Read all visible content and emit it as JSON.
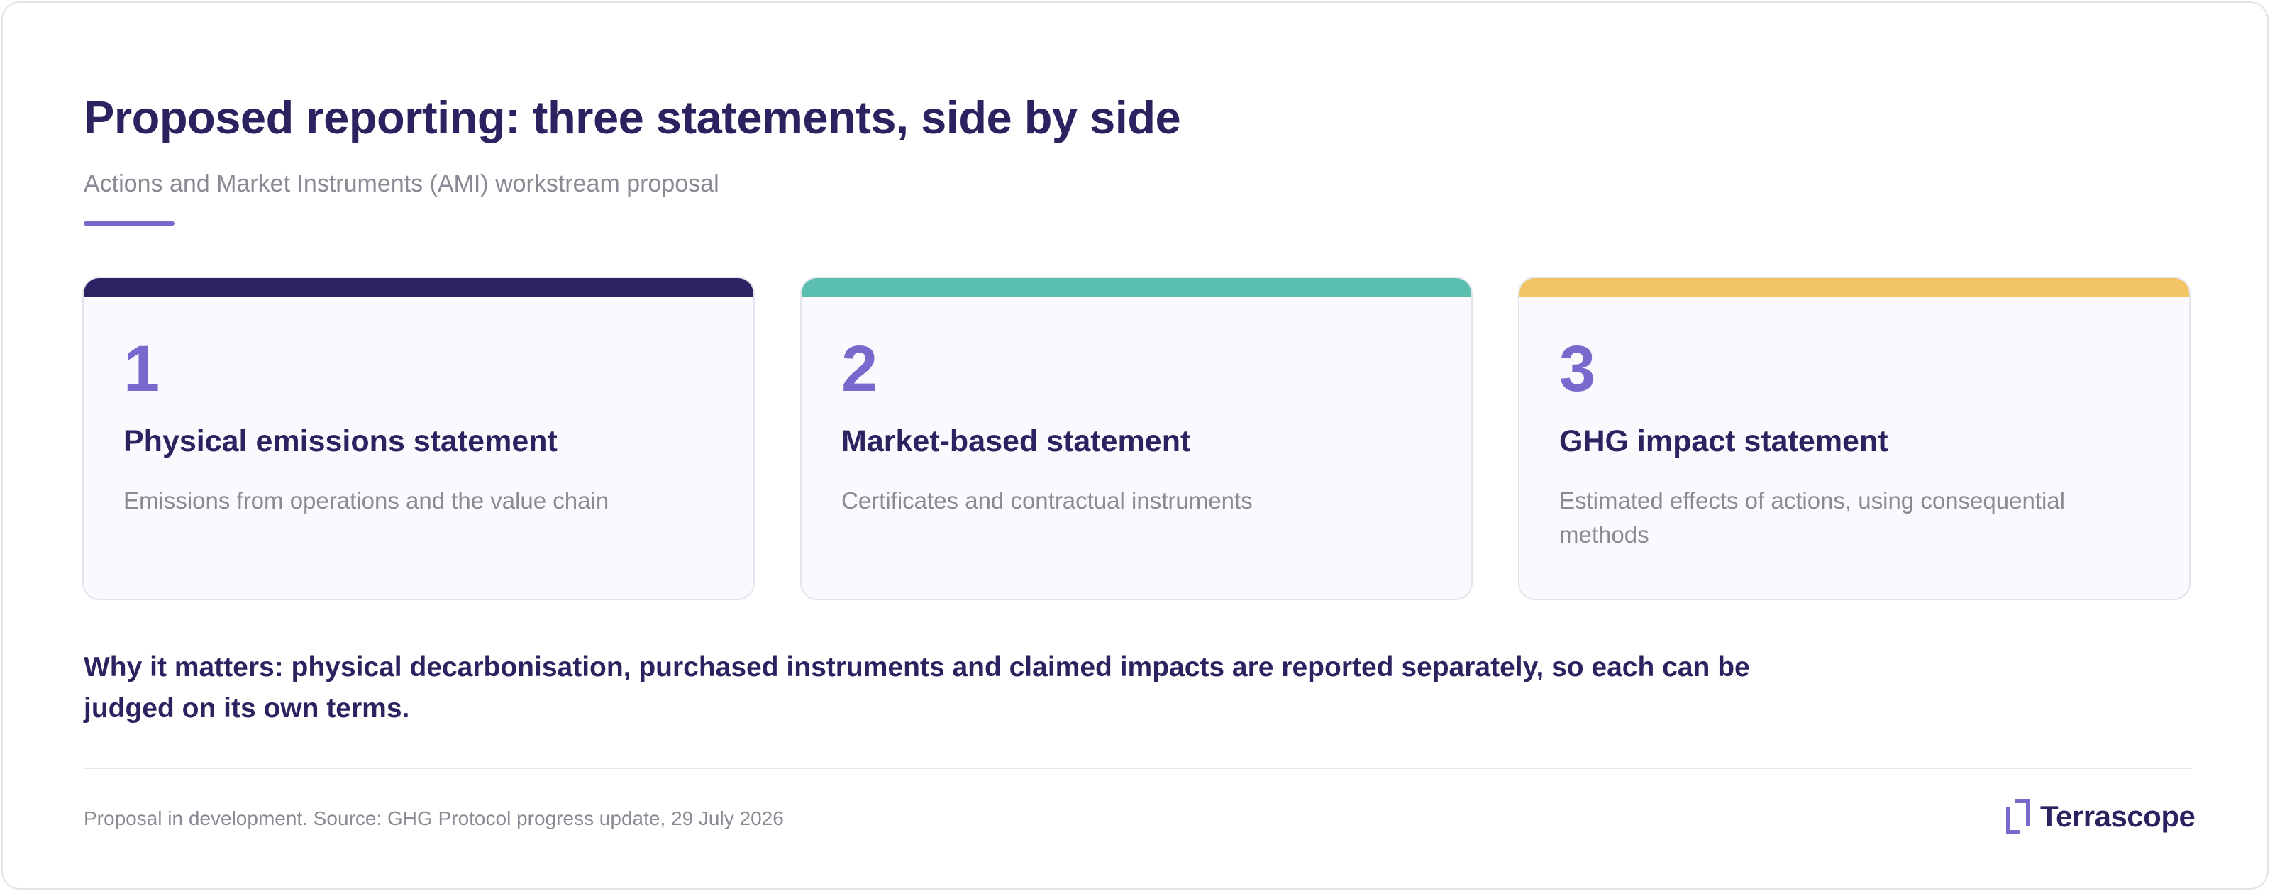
{
  "header": {
    "title": "Proposed reporting: three statements, side by side",
    "subtitle": "Actions and Market Instruments (AMI) workstream proposal"
  },
  "statements": [
    {
      "number": "1",
      "title": "Physical emissions statement",
      "description": "Emissions from operations and the value chain",
      "color": "#2d2264"
    },
    {
      "number": "2",
      "title": "Market-based statement",
      "description": "Certificates and contractual instruments",
      "color": "#5bbfb0"
    },
    {
      "number": "3",
      "title": "GHG impact statement",
      "description": "Estimated effects of actions, using consequential methods",
      "color": "#f2c464"
    }
  ],
  "summary": {
    "text": "Why it matters: physical decarbonisation, purchased instruments and claimed impacts are reported separately, so each can be judged on its own terms."
  },
  "footer": {
    "note": "Proposal in development. Source: GHG Protocol progress update, 29 July 2026",
    "brand": "Terrascope"
  },
  "colors": {
    "accent": "#7b68cc",
    "heading": "#2b2260",
    "muted": "#8a8a94"
  }
}
